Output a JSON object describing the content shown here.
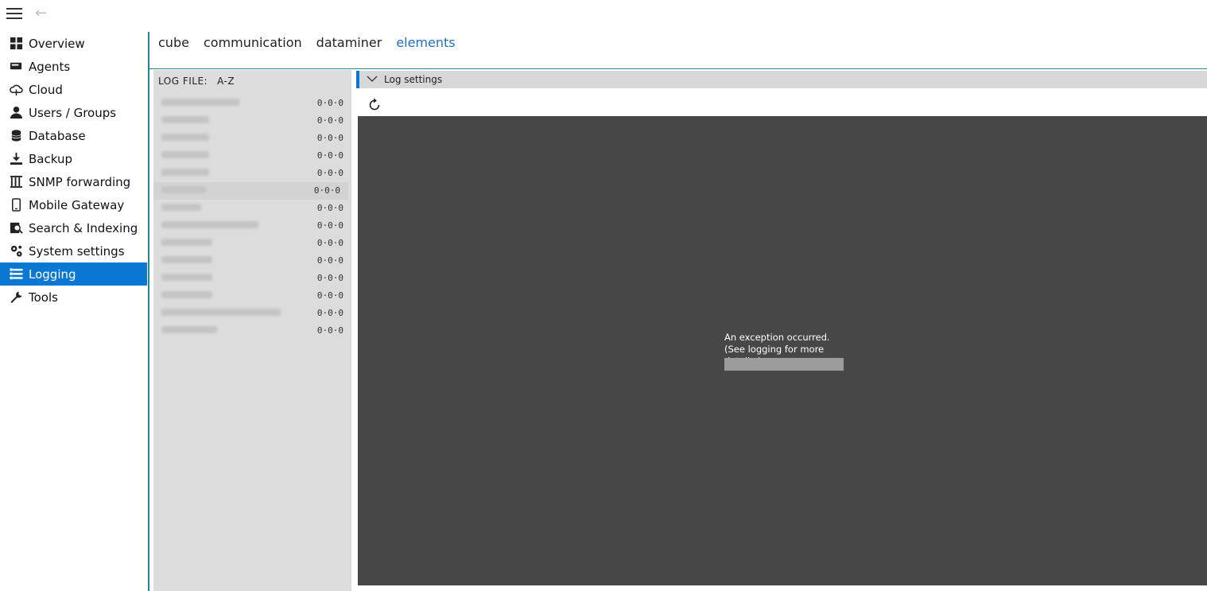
{
  "topbar": {
    "menu_icon": "hamburger-icon",
    "back_icon": "back-arrow-icon",
    "back_glyph": "←"
  },
  "sidebar": {
    "items": [
      {
        "label": "Overview",
        "icon": "grid-icon"
      },
      {
        "label": "Agents",
        "icon": "agent-icon"
      },
      {
        "label": "Cloud",
        "icon": "cloud-icon"
      },
      {
        "label": "Users / Groups",
        "icon": "user-icon"
      },
      {
        "label": "Database",
        "icon": "database-icon"
      },
      {
        "label": "Backup",
        "icon": "download-icon"
      },
      {
        "label": "SNMP forwarding",
        "icon": "snmp-icon"
      },
      {
        "label": "Mobile Gateway",
        "icon": "mobile-icon"
      },
      {
        "label": "Search & Indexing",
        "icon": "search-index-icon"
      },
      {
        "label": "System settings",
        "icon": "gears-icon"
      },
      {
        "label": "Logging",
        "icon": "list-icon",
        "active": true
      },
      {
        "label": "Tools",
        "icon": "wrench-icon"
      }
    ],
    "accent": "#0a78d2"
  },
  "tabs": [
    {
      "label": "cube"
    },
    {
      "label": "communication"
    },
    {
      "label": "dataminer"
    },
    {
      "label": "elements",
      "active": true
    }
  ],
  "logfiles": {
    "header": "LOG FILE:",
    "sort_label": "A-Z",
    "rows": [
      {
        "values": "0·0·0"
      },
      {
        "values": "0·0·0"
      },
      {
        "values": "0·0·0"
      },
      {
        "values": "0·0·0"
      },
      {
        "values": "0·0·0"
      },
      {
        "values": "0·0·0",
        "highlighted": true
      },
      {
        "values": "0·0·0"
      },
      {
        "values": "0·0·0"
      },
      {
        "values": "0·0·0"
      },
      {
        "values": "0·0·0"
      },
      {
        "values": "0·0·0"
      },
      {
        "values": "0·0·0"
      },
      {
        "values": "0·0·0"
      },
      {
        "values": "0·0·0"
      }
    ]
  },
  "log_settings": {
    "label": "Log settings",
    "chevron_icon": "chevron-down-icon",
    "refresh_icon": "refresh-icon"
  },
  "viewer": {
    "message": "An exception occurred. (See logging for more details.)",
    "background": "#474747"
  }
}
